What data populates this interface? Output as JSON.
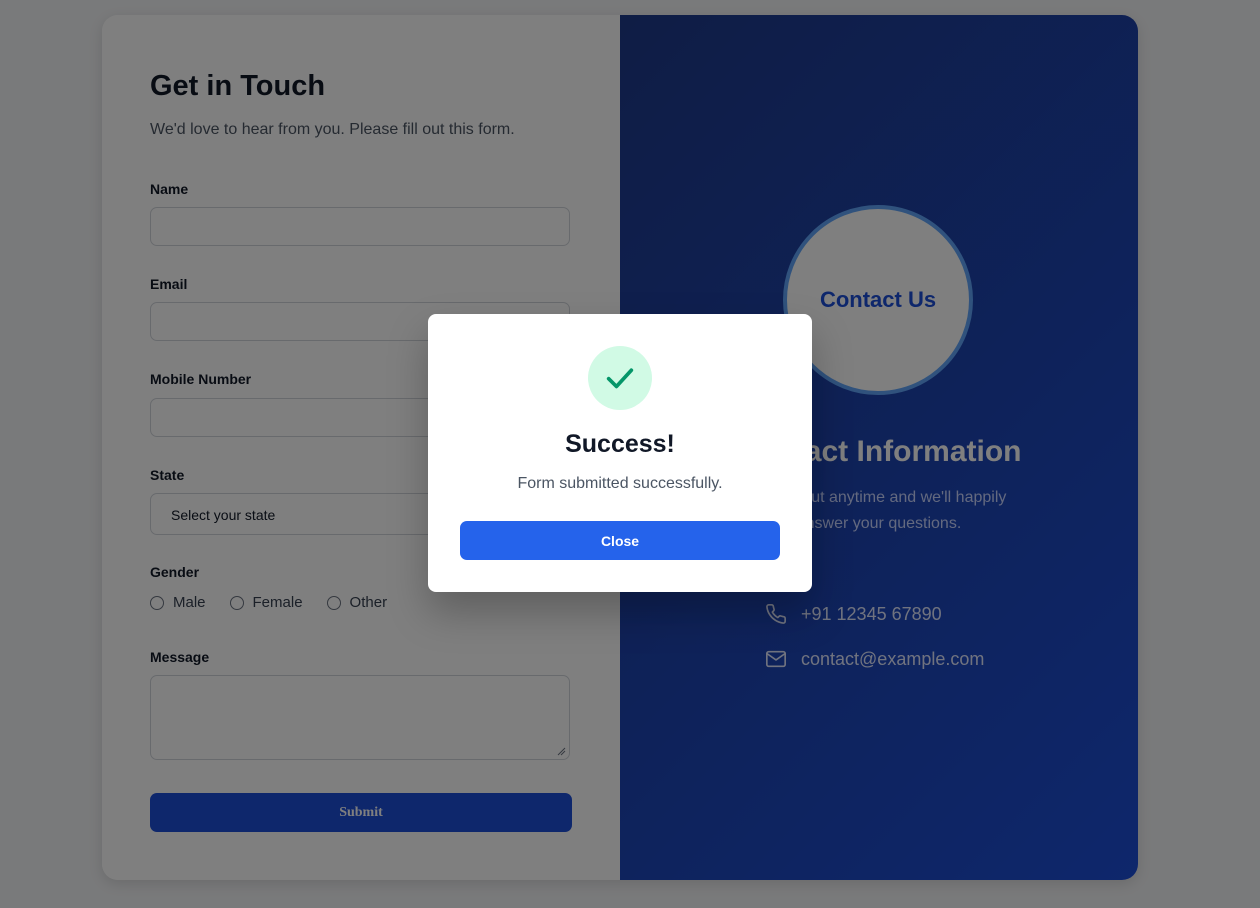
{
  "form": {
    "title": "Get in Touch",
    "subtitle": "We'd love to hear from you. Please fill out this form.",
    "name_label": "Name",
    "email_label": "Email",
    "mobile_label": "Mobile Number",
    "state_label": "State",
    "state_value": "Select your state",
    "gender_label": "Gender",
    "gender_options": [
      "Male",
      "Female",
      "Other"
    ],
    "message_label": "Message",
    "submit_label": "Submit"
  },
  "info": {
    "circle_text": "Contact Us",
    "title": "Contact Information",
    "description": "Reach out anytime and we'll happily answer your questions.",
    "phone": "+91 12345 67890",
    "email": "contact@example.com"
  },
  "modal": {
    "title": "Success!",
    "message": "Form submitted successfully.",
    "close_label": "Close"
  },
  "colors": {
    "accent": "#2563eb",
    "panel": "#1d4ed8",
    "success_bg": "#d1fae5",
    "success_check": "#059669"
  }
}
